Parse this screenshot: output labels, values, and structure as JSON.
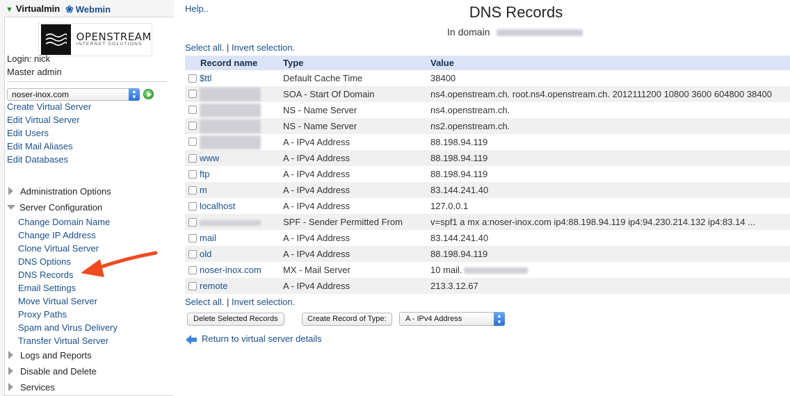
{
  "product_tabs": {
    "virtualmin": "Virtualmin",
    "webmin": "Webmin"
  },
  "logo": {
    "name": "OPENSTREAM",
    "tagline": "INTERNET SOLUTIONS"
  },
  "login": {
    "login_line": "Login: nick",
    "role": "Master admin"
  },
  "domain_select": {
    "value": "noser-inox.com"
  },
  "nav_links": [
    "Create Virtual Server",
    "Edit Virtual Server",
    "Edit Users",
    "Edit Mail Aliases",
    "Edit Databases"
  ],
  "categories": {
    "administration": "Administration Options",
    "server_config": "Server Configuration",
    "logs": "Logs and Reports",
    "disable": "Disable and Delete",
    "services": "Services"
  },
  "server_config_links": [
    "Change Domain Name",
    "Change IP Address",
    "Clone Virtual Server",
    "DNS Options",
    "DNS Records",
    "Email Settings",
    "Move Virtual Server",
    "Proxy Paths",
    "Spam and Virus Delivery",
    "Transfer Virtual Server"
  ],
  "help": "Help..",
  "page": {
    "title": "DNS Records",
    "subtitle_prefix": "In domain"
  },
  "selection": {
    "select_all": "Select all.",
    "separator": "|",
    "invert": "Invert selection."
  },
  "table": {
    "headers": {
      "name": "Record name",
      "type": "Type",
      "value": "Value"
    },
    "rows": [
      {
        "name": "$ttl",
        "type": "Default Cache Time",
        "value": "38400"
      },
      {
        "name": "",
        "type": "SOA - Start Of Domain",
        "value": "ns4.openstream.ch. root.ns4.openstream.ch. 2012111200 10800 3600 604800 38400"
      },
      {
        "name": "",
        "type": "NS - Name Server",
        "value": "ns4.openstream.ch."
      },
      {
        "name": "",
        "type": "NS - Name Server",
        "value": "ns2.openstream.ch."
      },
      {
        "name": "",
        "type": "A - IPv4 Address",
        "value": "88.198.94.119"
      },
      {
        "name": "www",
        "type": "A - IPv4 Address",
        "value": "88.198.94.119"
      },
      {
        "name": "ftp",
        "type": "A - IPv4 Address",
        "value": "88.198.94.119"
      },
      {
        "name": "m",
        "type": "A - IPv4 Address",
        "value": "83.144.241.40"
      },
      {
        "name": "localhost",
        "type": "A - IPv4 Address",
        "value": "127.0.0.1"
      },
      {
        "name": "",
        "type": "SPF - Sender Permitted From",
        "value": "v=spf1 a mx a:noser-inox.com ip4:88.198.94.119 ip4:94.230.214.132 ip4:83.14 ..."
      },
      {
        "name": "mail",
        "type": "A - IPv4 Address",
        "value": "83.144.241.40"
      },
      {
        "name": "old",
        "type": "A - IPv4 Address",
        "value": "88.198.94.119"
      },
      {
        "name": "noser-inox.com",
        "type": "MX - Mail Server",
        "value": "10 mail."
      },
      {
        "name": "remote",
        "type": "A - IPv4 Address",
        "value": "213.3.12.67"
      }
    ]
  },
  "buttons": {
    "delete": "Delete Selected Records",
    "create": "Create Record of Type:",
    "record_type": "A - IPv4 Address"
  },
  "return_link": "Return to virtual server details",
  "colors": {
    "link": "#1a4f8b",
    "header_bg": "#dbe4f6",
    "annotation_arrow": "#ee4a22"
  }
}
